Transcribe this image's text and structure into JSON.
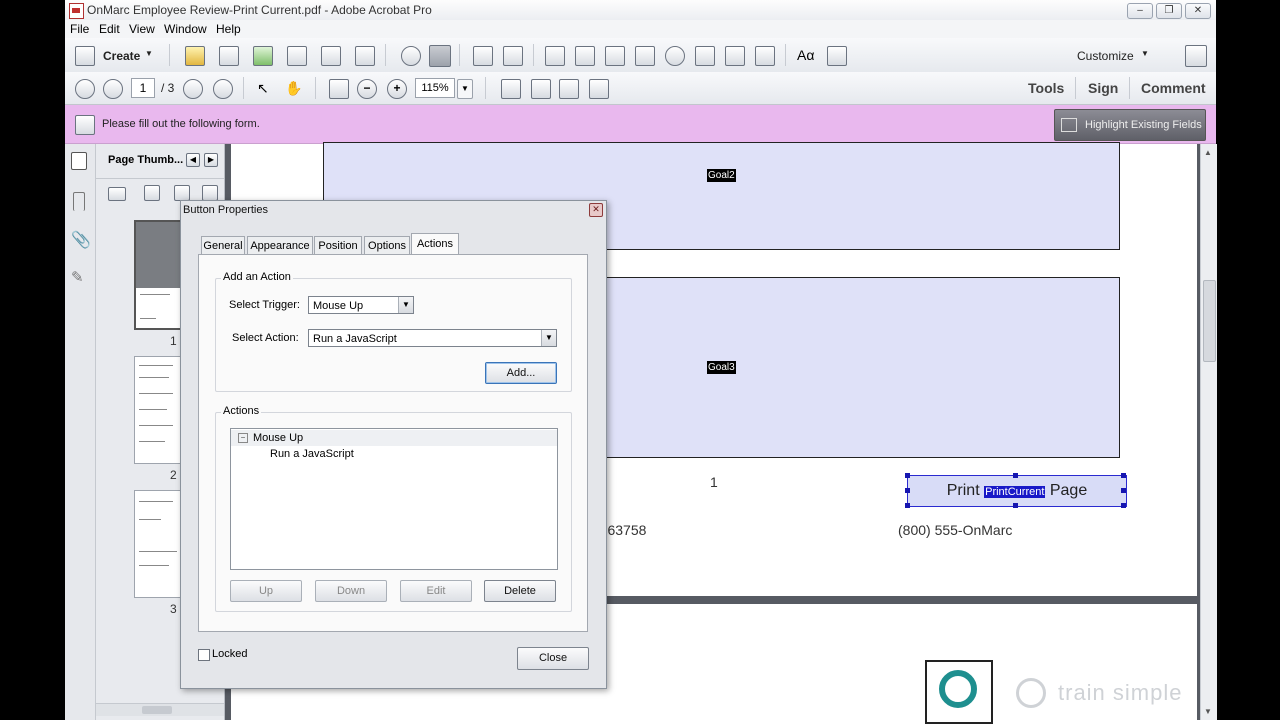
{
  "window": {
    "title": "OnMarc Employee Review-Print Current.pdf - Adobe Acrobat Pro"
  },
  "menu": [
    "File",
    "Edit",
    "View",
    "Window",
    "Help"
  ],
  "toolbar": {
    "create_label": "Create",
    "customize_label": "Customize",
    "page_current": "1",
    "page_total": "/ 3",
    "zoom": "115%",
    "tools_label": "Tools",
    "sign_label": "Sign",
    "comment_label": "Comment"
  },
  "formbar": {
    "message": "Please fill out the following form.",
    "highlight_label": "Highlight Existing Fields"
  },
  "nav": {
    "panel_title": "Page Thumb...",
    "thumbnails": [
      "1",
      "2",
      "3"
    ]
  },
  "document": {
    "field_goal2": "Goal2",
    "field_goal3": "Goal3",
    "page_number": "1",
    "address_fragment": "A 63758",
    "phone": "(800) 555-OnMarc",
    "print_button": {
      "before": "Print",
      "selected": "PrintCurrent",
      "after": "Page"
    }
  },
  "dialog": {
    "title": "Button Properties",
    "tabs": [
      "General",
      "Appearance",
      "Position",
      "Options",
      "Actions"
    ],
    "active_tab": "Actions",
    "add_action_label": "Add an Action",
    "select_trigger_label": "Select Trigger:",
    "select_trigger_value": "Mouse Up",
    "select_action_label": "Select Action:",
    "select_action_value": "Run a JavaScript",
    "add_button": "Add...",
    "actions_label": "Actions",
    "action_tree": {
      "trigger": "Mouse Up",
      "action": "Run a JavaScript"
    },
    "buttons": {
      "up": "Up",
      "down": "Down",
      "edit": "Edit",
      "delete": "Delete"
    },
    "locked_label": "Locked",
    "close_button": "Close"
  },
  "watermark": "train simple"
}
